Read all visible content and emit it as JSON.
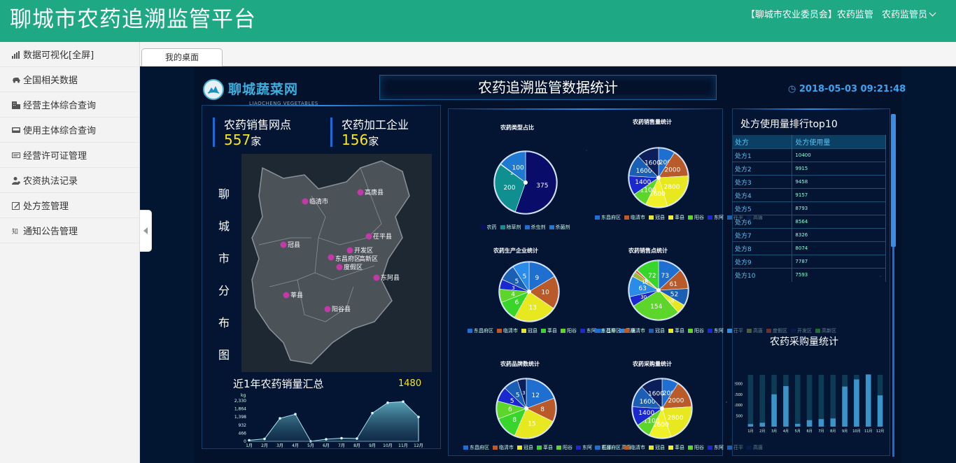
{
  "header": {
    "title": "聊城市农药追溯监管平台",
    "org": "【聊城市农业委员会】农药监管",
    "user": "农药监管员"
  },
  "sidebar": {
    "items": [
      {
        "label": "数据可视化[全屏]",
        "icon": "bar-chart-icon"
      },
      {
        "label": "全国相关数据",
        "icon": "car-icon"
      },
      {
        "label": "经营主体综合查询",
        "icon": "building-icon"
      },
      {
        "label": "使用主体综合查询",
        "icon": "monitor-icon"
      },
      {
        "label": "经营许可证管理",
        "icon": "card-icon"
      },
      {
        "label": "农资执法记录",
        "icon": "user-gear-icon"
      },
      {
        "label": "处方签管理",
        "icon": "edit-icon"
      },
      {
        "label": "通知公告管理",
        "icon": "notice-icon"
      }
    ]
  },
  "tabs": [
    {
      "label": "我的桌面"
    }
  ],
  "dashboard": {
    "logo_text": "聊城蔬菜网",
    "logo_sub": "LIAOCHENG VEGETABLES",
    "title": "农药追溯监管数据统计",
    "datetime": "2018-05-03 09:21:48",
    "outlets": {
      "label": "农药销售网点",
      "value": "557",
      "unit": "家"
    },
    "plants": {
      "label": "农药加工企业",
      "value": "156",
      "unit": "家"
    },
    "map_title": "聊城市分布图",
    "map_labels": [
      "临清市",
      "高唐县",
      "茌平县",
      "冠县",
      "开发区",
      "东昌府区",
      "高新区",
      "度假区",
      "东阿县",
      "莘县",
      "阳谷县"
    ],
    "sales_title": "近1年农药销量汇总",
    "sales_total": "1480",
    "rank_title": "处方使用量排行top10",
    "rank_headers": [
      "处方",
      "处方使用量"
    ],
    "rank_rows": [
      [
        "处方1",
        "10400"
      ],
      [
        "处方2",
        "9915"
      ],
      [
        "处方3",
        "9458"
      ],
      [
        "处方4",
        "9157"
      ],
      [
        "处方5",
        "8793"
      ],
      [
        "处方6",
        "8564"
      ],
      [
        "处方7",
        "8326"
      ],
      [
        "处方8",
        "8074"
      ],
      [
        "处方9",
        "7787"
      ],
      [
        "处方10",
        "7593"
      ]
    ],
    "purchase_title": "农药采购量统计"
  },
  "colors": {
    "accent": "#1ea883",
    "bg": "#04112b",
    "highlight": "#f7e71c"
  },
  "chart_data": [
    {
      "type": "area",
      "title": "近1年农药销量汇总",
      "ylabel": "kg",
      "categories": [
        "1月",
        "2月",
        "3月",
        "4月",
        "5月",
        "6月",
        "7月",
        "8月",
        "9月",
        "10月",
        "11月",
        "12月"
      ],
      "values": [
        60,
        140,
        1320,
        1560,
        0,
        120,
        180,
        160,
        1620,
        2220,
        2280,
        1400
      ],
      "yticks": [
        "0",
        "466",
        "932",
        "1,398",
        "1,864",
        "2,330"
      ],
      "ylim": [
        0,
        2330
      ]
    },
    {
      "type": "pie",
      "title": "农药类型占比",
      "labels": [
        "农药",
        "除草剂",
        "杀虫剂",
        "杀菌剂"
      ],
      "values": [
        375,
        200,
        2,
        100
      ],
      "colors": [
        "#0a0c6a",
        "#0f8f8f",
        "#1e6fd0",
        "#1e7ad0"
      ]
    },
    {
      "type": "pie",
      "title": "农药销售量统计",
      "labels": [
        "东昌府区",
        "临清市",
        "冠县",
        "莘县",
        "阳谷",
        "东阿",
        "茌平",
        "高唐"
      ],
      "values": [
        1200,
        2000,
        2800,
        1600,
        1100,
        1400,
        1600,
        1600
      ],
      "colors": [
        "#1e6fd0",
        "#b85a2a",
        "#e8e820",
        "#f1f12a",
        "#5cd62a",
        "#1a28d0",
        "#1a5fb4",
        "#0c1f5a"
      ]
    },
    {
      "type": "pie",
      "title": "农药生产企业统计",
      "labels": [
        "东昌府区",
        "临清市",
        "冠县",
        "莘县",
        "阳谷",
        "东阿",
        "茌平",
        "高唐"
      ],
      "values": [
        9,
        10,
        13,
        6,
        4,
        3,
        5,
        5
      ],
      "colors": [
        "#1e6fd0",
        "#b85a2a",
        "#e8e820",
        "#38d62a",
        "#5cd62a",
        "#1a28d0",
        "#1a5fb4",
        "#2a8be8"
      ]
    },
    {
      "type": "pie",
      "title": "农药销售点统计",
      "labels": [
        "东昌府区",
        "临清市",
        "冠县",
        "莘县",
        "阳谷",
        "东阿",
        "茌平",
        "高唐",
        "度假区",
        "开发区",
        "高新区"
      ],
      "values": [
        73,
        61,
        52,
        28,
        154,
        30,
        63,
        16,
        6,
        2,
        72
      ],
      "colors": [
        "#1e6fd0",
        "#b85a2a",
        "#1a5fb4",
        "#e8e820",
        "#5cd62a",
        "#1a28d0",
        "#2a8be8",
        "#a3b83a",
        "#e84a1e",
        "#0c1f5a",
        "#38d62a"
      ]
    },
    {
      "type": "pie",
      "title": "农药品牌数统计",
      "labels": [
        "东昌府区",
        "临清市",
        "冠县",
        "莘县",
        "阳谷",
        "东阿",
        "茌平",
        "高唐"
      ],
      "values": [
        12,
        8,
        15,
        8,
        6,
        5,
        5,
        3
      ],
      "colors": [
        "#1e6fd0",
        "#b85a2a",
        "#e8e820",
        "#38d62a",
        "#5cd62a",
        "#1a28d0",
        "#1a5fb4",
        "#0c1f5a"
      ]
    },
    {
      "type": "pie",
      "title": "农药采购量统计",
      "labels": [
        "东昌府区",
        "临清市",
        "冠县",
        "莘县",
        "阳谷",
        "东阿",
        "茌平",
        "高唐"
      ],
      "values": [
        1200,
        2000,
        2800,
        1600,
        1100,
        1400,
        1600,
        1600
      ],
      "colors": [
        "#1e6fd0",
        "#b85a2a",
        "#e8e820",
        "#f1f12a",
        "#5cd62a",
        "#1a28d0",
        "#1a5fb4",
        "#0c1f5a"
      ]
    },
    {
      "type": "bar",
      "title": "农药采购量统计",
      "categories": [
        "1月",
        "2月",
        "3月",
        "4月",
        "5月",
        "6月",
        "7月",
        "8月",
        "9月",
        "10月",
        "11月",
        "12月"
      ],
      "values": [
        120,
        180,
        1500,
        1880,
        130,
        300,
        350,
        380,
        1860,
        2190,
        2420,
        1450
      ],
      "background": [
        2400,
        2400,
        2400,
        2400,
        2400,
        2400,
        2400,
        2400,
        2400,
        2400,
        2400,
        2400
      ],
      "yticks": [
        "500",
        "1000",
        "1500",
        "2000"
      ],
      "ylim": [
        0,
        2400
      ]
    }
  ]
}
